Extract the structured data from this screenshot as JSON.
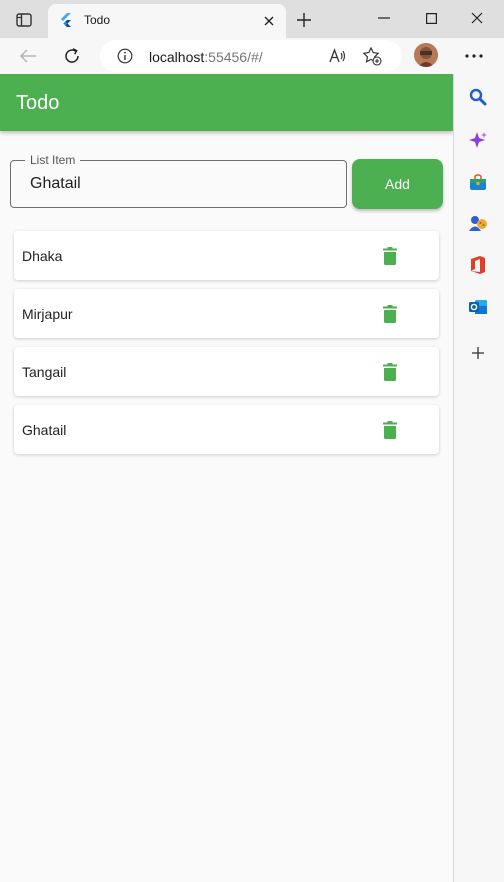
{
  "browser": {
    "tab": {
      "title": "Todo",
      "favicon": "flutter-icon"
    },
    "address": {
      "host": "localhost",
      "path": ":55456/#/"
    },
    "icons": {
      "tab_actions": "tab-actions-icon",
      "close_tab": "close-icon",
      "new_tab": "plus-icon",
      "back": "back-arrow-icon",
      "refresh": "refresh-icon",
      "info": "info-icon",
      "read_aloud": "read-aloud-icon",
      "favorite": "favorite-add-icon",
      "more": "more-icon"
    }
  },
  "app": {
    "title": "Todo",
    "accent_color": "#4caf50",
    "input": {
      "label": "List Item",
      "value": "Ghatail"
    },
    "add_button": "Add",
    "items": [
      {
        "label": "Dhaka"
      },
      {
        "label": "Mirjapur"
      },
      {
        "label": "Tangail"
      },
      {
        "label": "Ghatail"
      }
    ]
  },
  "sidebar": {
    "icons": [
      "search-icon",
      "copilot-icon",
      "shopping-icon",
      "games-icon",
      "office-icon",
      "outlook-icon",
      "add-icon"
    ]
  }
}
